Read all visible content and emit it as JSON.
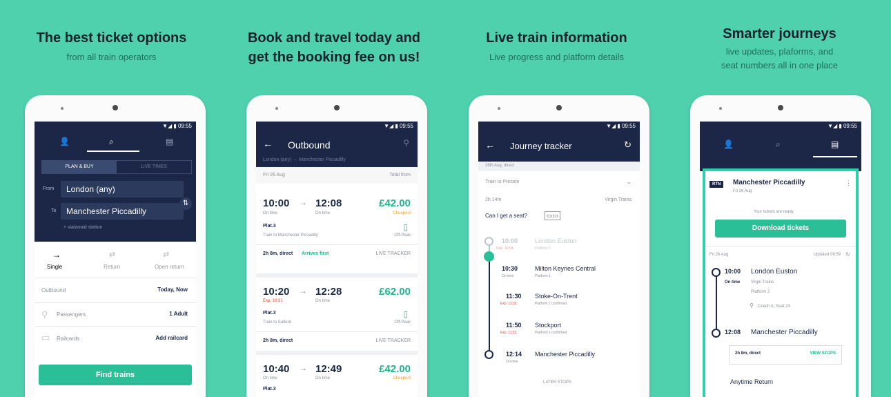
{
  "panels": [
    {
      "title": "The best ticket options",
      "subtitle": "from all train operators"
    },
    {
      "title_line1": "Book and travel today and",
      "title_line2": "get the booking fee on us!"
    },
    {
      "title": "Live train information",
      "subtitle": "Live progress and platform details"
    },
    {
      "title": "Smarter journeys",
      "subtitle_line1": "live updates, plaforms, and",
      "subtitle_line2": "seat numbers all in one place"
    }
  ],
  "s1": {
    "status": "▼◢ ▮ 09:55",
    "toggle": [
      "PLAN & BUY",
      "LIVE TIMES"
    ],
    "from_label": "From",
    "from_value": "London (any)",
    "to_label": "To",
    "to_value": "Manchester Piccadilly",
    "via": "+ via/avoid station",
    "modes": [
      "Single",
      "Return",
      "Open return"
    ],
    "outbound_label": "Outbound",
    "outbound_value": "Today, Now",
    "passengers_label": "Passengers",
    "passengers_value": "1 Adult",
    "railcards_label": "Railcards",
    "railcards_value": "Add railcard",
    "find_btn": "Find trains"
  },
  "s2": {
    "status": "▼◢ ▮ 09:55",
    "title": "Outbound",
    "route": "London (any) → Manchester Piccadilly",
    "date": "Fri 26 Aug",
    "total": "Total from",
    "results": [
      {
        "dep": "10:00",
        "dep_sub": "On time",
        "arr": "12:08",
        "arr_sub": "On time",
        "price": "£42.00",
        "price_tag": "Cheapest",
        "plat": "Plat.3",
        "to": "Train to Manchester Piccadilly",
        "fare": "Off-Peak",
        "dur": "2h 8m, direct",
        "badge": "Arrives first",
        "tracker": "LIVE TRACKER"
      },
      {
        "dep": "10:20",
        "dep_sub": "Exp. 10:31",
        "arr": "12:28",
        "arr_sub": "On time",
        "price": "£62.00",
        "plat": "Plat.3",
        "to": "Train to Salford",
        "fare": "Off-Peak",
        "dur": "2h 8m, direct",
        "tracker": "LIVE TRACKER"
      },
      {
        "dep": "10:40",
        "dep_sub": "On time",
        "arr": "12:49",
        "arr_sub": "On time",
        "price": "£42.00",
        "price_tag": "Cheapest",
        "plat": "Plat.3"
      }
    ]
  },
  "s3": {
    "status": "▼◢ ▮ 09:55",
    "title": "Journey tracker",
    "date": "26th Aug, direct",
    "train": "Train to Preston",
    "dur": "2h 14m",
    "operator": "Virgin Trains",
    "seat_q": "Can I get a seat?",
    "stops": [
      {
        "time": "10:00",
        "exp": "Dep. 10:04",
        "name": "London Euston",
        "plat": "Platform 6"
      },
      {
        "time": "10:30",
        "exp": "On time",
        "name": "Milton Keynes Central",
        "plat": "Platform 1"
      },
      {
        "time": "11:30",
        "exp": "Exp. 11:32",
        "name": "Stoke-On-Trent",
        "plat": "Platform 2 confirmed"
      },
      {
        "time": "11:50",
        "exp": "Exp. 11:52",
        "name": "Stockport",
        "plat": "Platform 1 confirmed"
      },
      {
        "time": "12:14",
        "exp": "On time",
        "name": "Manchester Piccadilly",
        "plat": ""
      }
    ],
    "later": "LATER STOPS"
  },
  "s4": {
    "status": "▼◢ ▮ 09:55",
    "badge": "RTN",
    "dest": "Manchester Piccadilly",
    "dest_date": "Fri 26 Aug",
    "ready": "Your tickets are ready",
    "download": "Download tickets",
    "date": "Fri 26 Aug",
    "updated": "Updated 09:59",
    "dep_time": "10:00",
    "dep_name": "London Euston",
    "dep_status": "On time",
    "operator": "Virgin Trains",
    "plat": "Platform 2",
    "coach": "Coach A, Seat 23",
    "arr_time": "12:08",
    "arr_name": "Manchester Piccadilly",
    "dur": "2h 8m, direct",
    "view_stops": "VIEW STOPS",
    "fare": "Anytime Return"
  },
  "colors": {
    "bg": "#4fd1ae",
    "navy": "#1c2747",
    "accent": "#2bbf98",
    "delay": "#e0463d"
  }
}
